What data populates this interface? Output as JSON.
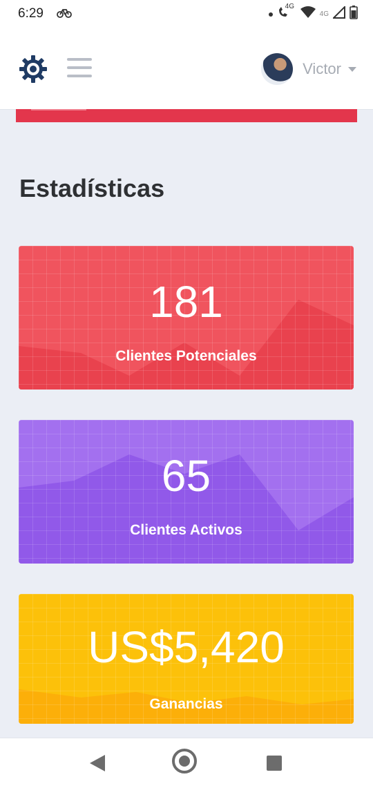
{
  "status_bar": {
    "time": "6:29",
    "signal_label_1": "4G",
    "signal_label_2": "4G",
    "icons": [
      "bike-notification-icon",
      "call-4g-icon",
      "wifi-icon",
      "signal-4g-icon",
      "battery-icon"
    ]
  },
  "header": {
    "settings_icon": "gear-icon",
    "menu_icon": "hamburger-menu-icon",
    "user_name": "Victor",
    "dropdown_icon": "caret-down-icon"
  },
  "section": {
    "title": "Estadísticas"
  },
  "stats": [
    {
      "value": "181",
      "label": "Clientes Potenciales",
      "color": "#f0545e"
    },
    {
      "value": "65",
      "label": "Clientes Activos",
      "color": "#a370ef"
    },
    {
      "value": "US$5,420",
      "label": "Ganancias",
      "color": "#fcc10a"
    }
  ],
  "accent_strip_color": "#e3364c",
  "nav_bar": {
    "icons": [
      "back-icon",
      "home-icon",
      "recent-apps-icon"
    ]
  }
}
